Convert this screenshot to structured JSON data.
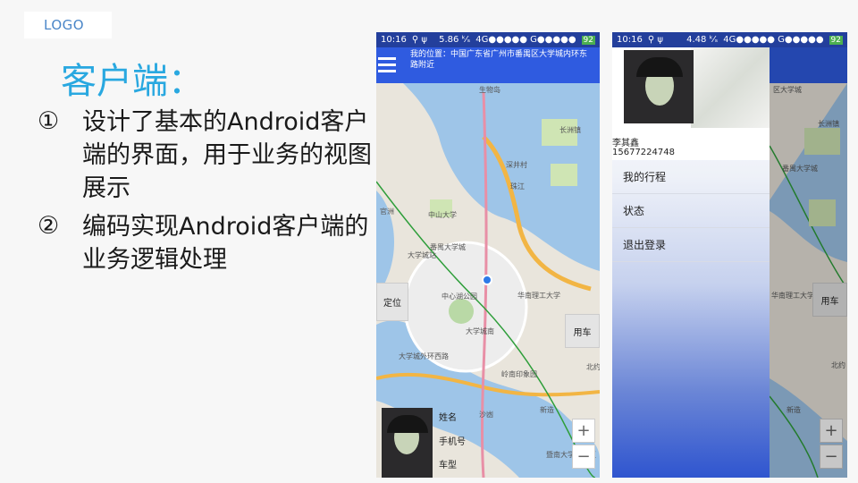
{
  "slide": {
    "logo": "LOGO",
    "title": "客户端：",
    "bullets": [
      {
        "num": "①",
        "text": "设计了基本的Android客户端的界面，用于业务的视图展示"
      },
      {
        "num": "②",
        "text": "编码实现Android客户端的业务逻辑处理"
      }
    ]
  },
  "phone1": {
    "status": {
      "time": "10:16",
      "icons": "⚲ ψ",
      "speed": "5.86 ᵏ⁄ₛ",
      "net": "4G●●●●● G●●●●●",
      "battery": "92"
    },
    "location": "我的位置：中国广东省广州市番禺区大学城内环东路附近",
    "buttons": {
      "locate": "定位",
      "use_car": "用车",
      "zoom_in": "+",
      "zoom_out": "−"
    },
    "labels": {
      "name": "姓名",
      "phone": "手机号",
      "car": "车型"
    },
    "map_labels": [
      "中山大学",
      "大学城站",
      "中心湖公园",
      "华南理工大学",
      "大学城南",
      "大学城外环西路",
      "岭南印象园",
      "长洲镇",
      "深井村",
      "新造",
      "沙凼",
      "北约",
      "官洲",
      "番禺大学城",
      "暨南大学南校区",
      "生物岛",
      "珠江"
    ]
  },
  "phone2": {
    "status": {
      "time": "10:16",
      "icons": "⚲ ψ",
      "speed": "4.48 ᵏ⁄ₛ",
      "net": "4G●●●●● G●●●●●",
      "battery": "92"
    },
    "user_name": "李其鑫",
    "user_phone": "15677224748",
    "menu": [
      "我的行程",
      "状态",
      "退出登录"
    ],
    "buttons": {
      "use_car": "用车",
      "zoom_in": "+",
      "zoom_out": "−"
    },
    "map_labels": [
      "长洲镇",
      "番禺大学城",
      "新造",
      "华南理工大学",
      "区大学城",
      "北约"
    ]
  },
  "colors": {
    "title": "#29a8e0",
    "appbar": "#2f5be0",
    "statusbar": "#233f9c",
    "route": "#2e9e3a",
    "road": "#f2b544",
    "water": "#9ec5e8"
  }
}
